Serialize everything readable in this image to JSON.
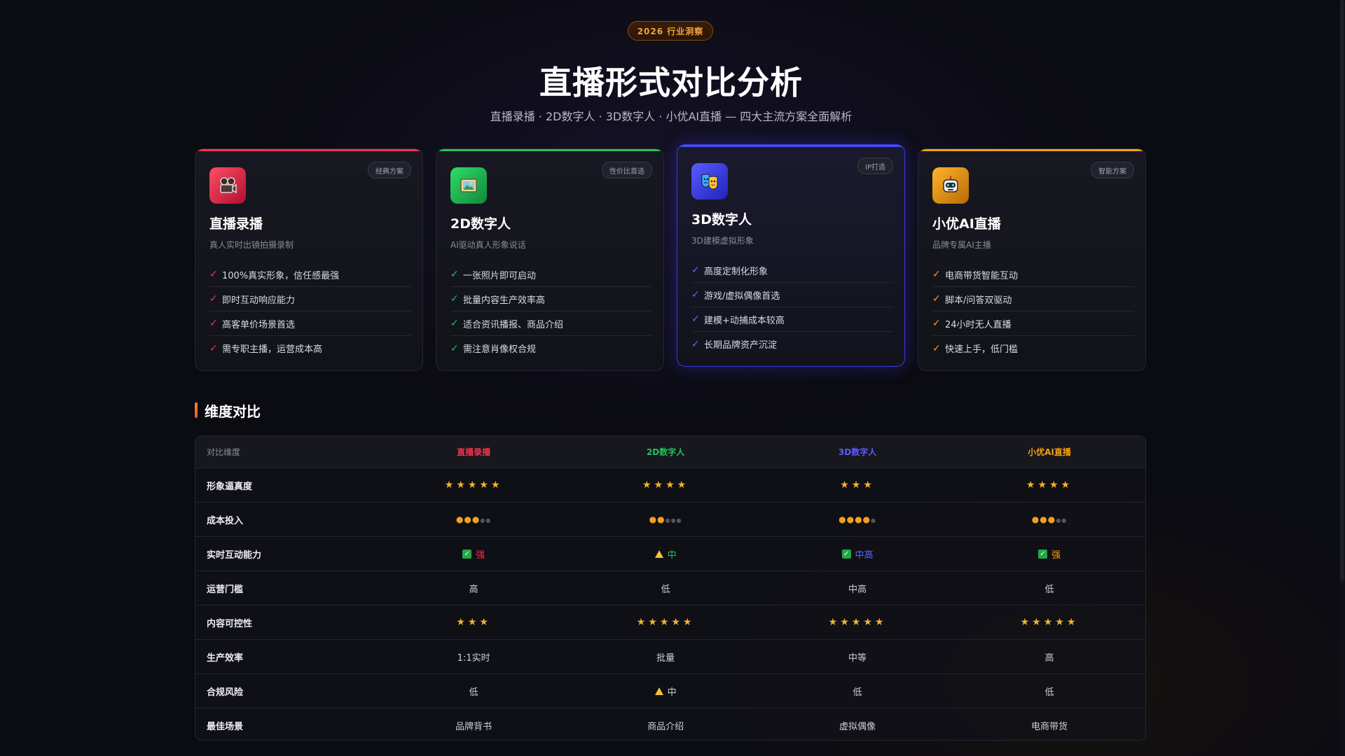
{
  "header": {
    "badge": "2026 行业洞察",
    "title": "直播形式对比分析",
    "subtitle": "直播录播 · 2D数字人 · 3D数字人 · 小优AI直播 — 四大主流方案全面解析"
  },
  "colors": {
    "red": "#f0364e",
    "green": "#20c45a",
    "blue": "#4a4cf2",
    "orange": "#f5a011"
  },
  "cards": [
    {
      "name": "直播录播",
      "desc": "真人实时出镜拍摄录制",
      "tag": "经典方案",
      "icon": "video-camera-icon",
      "features": [
        "100%真实形象，信任感最强",
        "即时互动响应能力",
        "高客单价场景首选",
        "需专职主播，运营成本高"
      ]
    },
    {
      "name": "2D数字人",
      "desc": "AI驱动真人形象说话",
      "tag": "性价比首选",
      "icon": "picture-icon",
      "features": [
        "一张照片即可启动",
        "批量内容生产效率高",
        "适合资讯播报、商品介绍",
        "需注意肖像权合规"
      ]
    },
    {
      "name": "3D数字人",
      "desc": "3D建模虚拟形象",
      "tag": "IP打造",
      "icon": "theater-masks-icon",
      "features": [
        "高度定制化形象",
        "游戏/虚拟偶像首选",
        "建模+动捕成本较高",
        "长期品牌资产沉淀"
      ]
    },
    {
      "name": "小优AI直播",
      "desc": "品牌专属AI主播",
      "tag": "智能方案",
      "icon": "robot-icon",
      "features": [
        "电商带货智能互动",
        "脚本/问答双驱动",
        "24小时无人直播",
        "快速上手，低门槛"
      ]
    }
  ],
  "comparison": {
    "section_title": "维度对比",
    "header_label": "对比维度",
    "columns": [
      "直播录播",
      "2D数字人",
      "3D数字人",
      "小优AI直播"
    ],
    "rows": [
      {
        "label": "形象逼真度",
        "type": "stars",
        "values": [
          5,
          4,
          3,
          4
        ]
      },
      {
        "label": "成本投入",
        "type": "dots",
        "max": 5,
        "values": [
          3,
          2,
          4,
          3
        ]
      },
      {
        "label": "实时互动能力",
        "type": "status",
        "values": [
          {
            "icon": "check",
            "text": "强"
          },
          {
            "icon": "warn",
            "text": "中"
          },
          {
            "icon": "check",
            "text": "中高"
          },
          {
            "icon": "check",
            "text": "强"
          }
        ]
      },
      {
        "label": "运营门槛",
        "type": "text",
        "values": [
          "高",
          "低",
          "中高",
          "低"
        ]
      },
      {
        "label": "内容可控性",
        "type": "stars",
        "values": [
          3,
          5,
          5,
          5
        ]
      },
      {
        "label": "生产效率",
        "type": "text",
        "values": [
          "1:1实时",
          "批量",
          "中等",
          "高"
        ]
      },
      {
        "label": "合规风险",
        "type": "status",
        "values": [
          {
            "icon": "none",
            "text": "低"
          },
          {
            "icon": "warn",
            "text": "中"
          },
          {
            "icon": "none",
            "text": "低"
          },
          {
            "icon": "none",
            "text": "低"
          }
        ]
      },
      {
        "label": "最佳场景",
        "type": "text",
        "values": [
          "品牌背书",
          "商品介绍",
          "虚拟偶像",
          "电商带货"
        ]
      }
    ]
  }
}
